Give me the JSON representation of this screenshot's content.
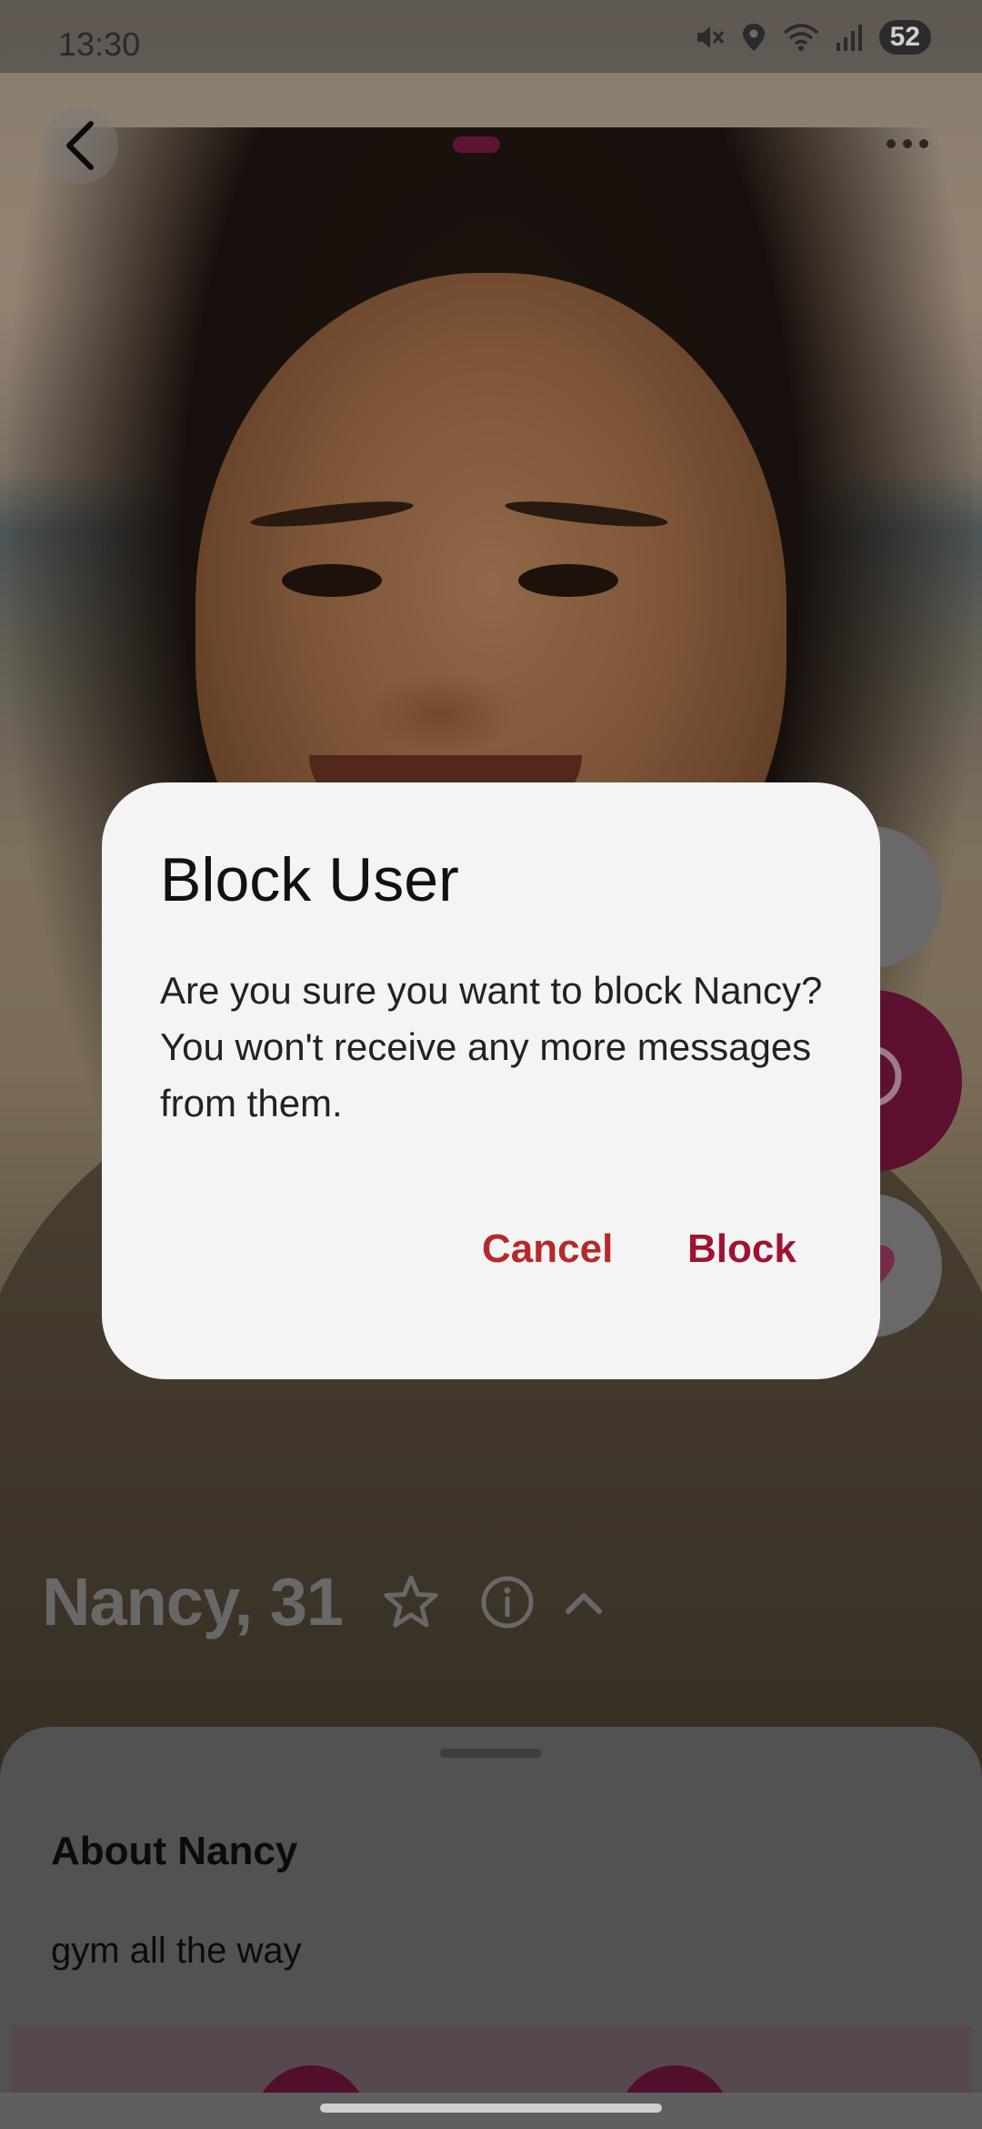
{
  "status_bar": {
    "time": "13:30",
    "battery": "52",
    "icons": [
      "mute-icon",
      "location-icon",
      "wifi-icon",
      "signal-icon"
    ]
  },
  "profile": {
    "name_age": "Nancy, 31",
    "about_title": "About Nancy",
    "about_text": "gym all the way"
  },
  "dialog": {
    "title": "Block User",
    "message": "Are you sure you want to block Nancy? You won't receive any more messages from them.",
    "cancel_label": "Cancel",
    "confirm_label": "Block"
  },
  "colors": {
    "accent": "#8a1848",
    "dialog_button": "#b3202a",
    "dialog_bg": "#f4f4f4"
  }
}
